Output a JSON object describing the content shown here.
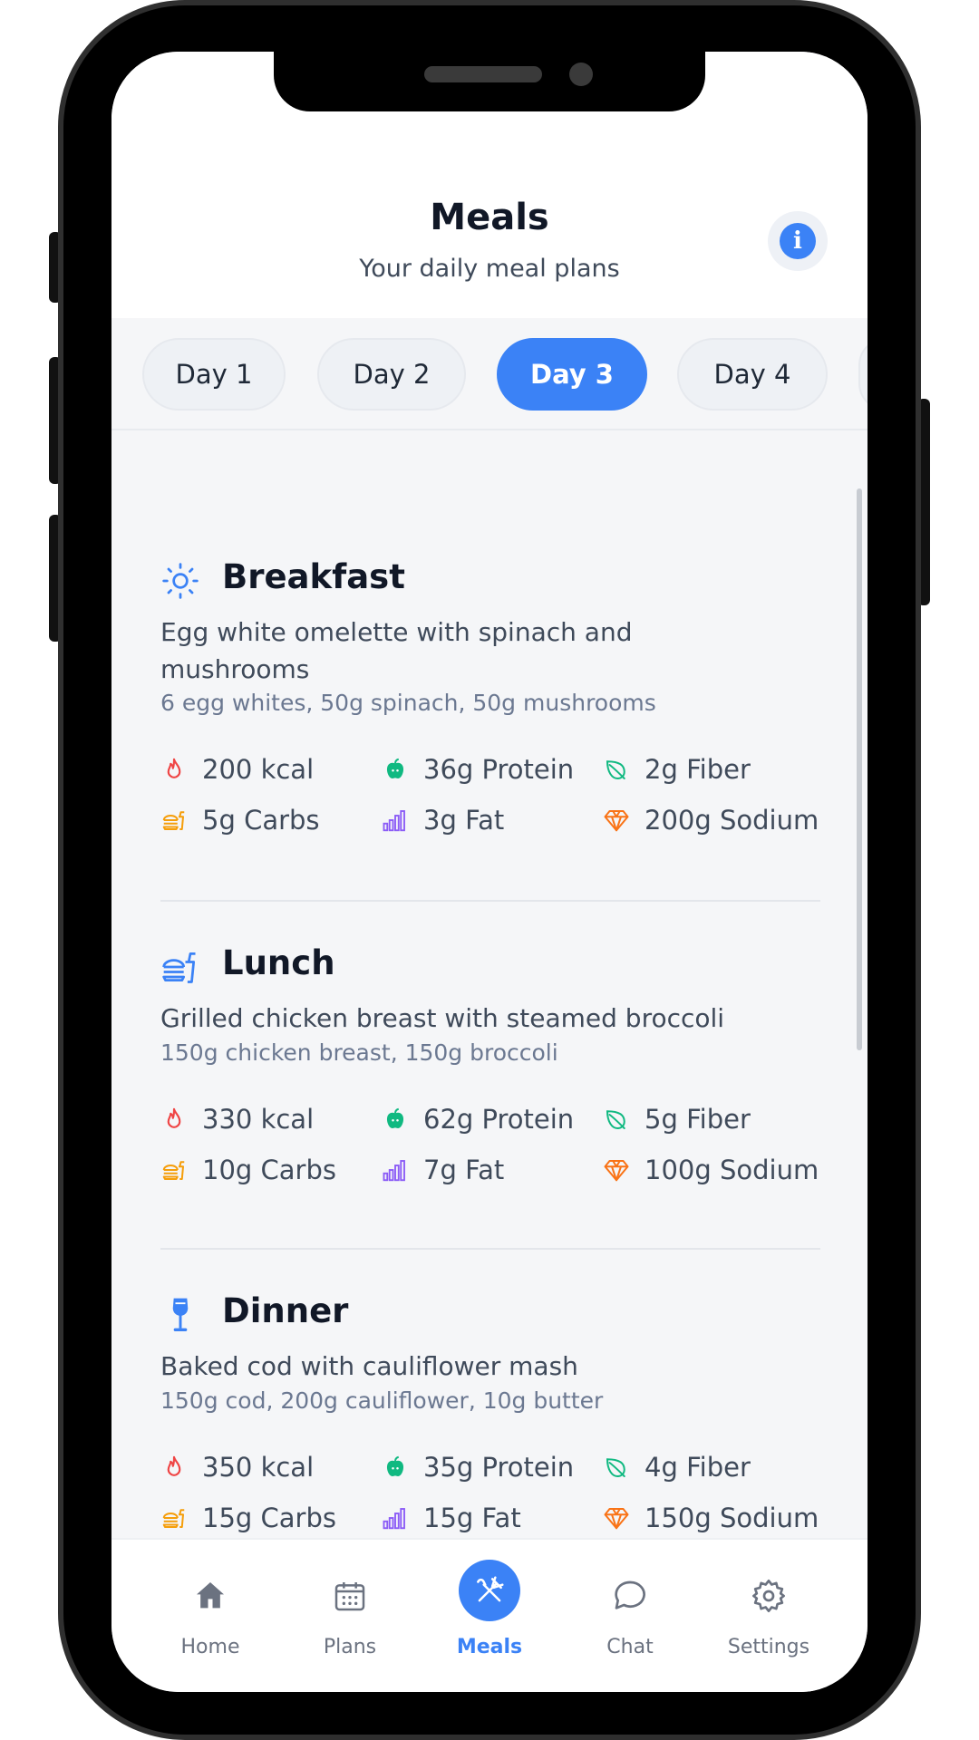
{
  "header": {
    "title": "Meals",
    "subtitle": "Your daily meal plans",
    "info_icon": "i"
  },
  "tabs": [
    {
      "label": "Day 1",
      "active": false
    },
    {
      "label": "Day 2",
      "active": false
    },
    {
      "label": "Day 3",
      "active": true
    },
    {
      "label": "Day 4",
      "active": false
    }
  ],
  "meals": [
    {
      "name": "Breakfast",
      "icon": "sun-icon",
      "description": "Egg white omelette with spinach and mushrooms",
      "ingredients": "6 egg whites, 50g spinach, 50g mushrooms",
      "stats": {
        "calories": "200 kcal",
        "protein": "36g Protein",
        "fiber": "2g Fiber",
        "carbs": "5g Carbs",
        "fat": "3g Fat",
        "sodium": "200g Sodium"
      }
    },
    {
      "name": "Lunch",
      "icon": "fast-food-icon",
      "description": "Grilled chicken breast with steamed broccoli",
      "ingredients": "150g chicken breast, 150g broccoli",
      "stats": {
        "calories": "330 kcal",
        "protein": "62g Protein",
        "fiber": "5g Fiber",
        "carbs": "10g Carbs",
        "fat": "7g Fat",
        "sodium": "100g Sodium"
      }
    },
    {
      "name": "Dinner",
      "icon": "wine-glass-icon",
      "description": "Baked cod with cauliflower mash",
      "ingredients": "150g cod, 200g cauliflower, 10g butter",
      "stats": {
        "calories": "350 kcal",
        "protein": "35g Protein",
        "fiber": "4g Fiber",
        "carbs": "15g Carbs",
        "fat": "15g Fat",
        "sodium": "150g Sodium"
      }
    }
  ],
  "nav": [
    {
      "label": "Home",
      "icon": "home-icon",
      "active": false
    },
    {
      "label": "Plans",
      "icon": "calendar-icon",
      "active": false
    },
    {
      "label": "Meals",
      "icon": "fork-knife-icon",
      "active": true
    },
    {
      "label": "Chat",
      "icon": "chat-bubble-icon",
      "active": false
    },
    {
      "label": "Settings",
      "icon": "gear-icon",
      "active": false
    }
  ],
  "colors": {
    "accent": "#3b82f6",
    "calories": "#ef4444",
    "protein": "#10b981",
    "fiber": "#10b981",
    "carbs": "#f59e0b",
    "fat": "#8b5cf6",
    "sodium": "#f97316"
  }
}
